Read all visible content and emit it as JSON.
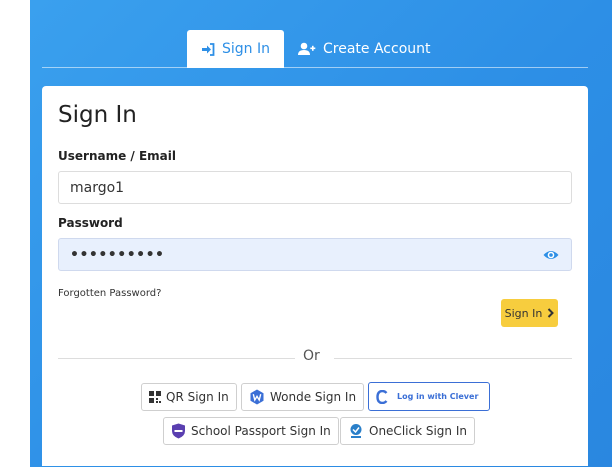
{
  "tabs": {
    "signin_label": "Sign In",
    "create_label": "Create Account"
  },
  "form": {
    "title": "Sign In",
    "username_label": "Username / Email",
    "username_value": "margo1",
    "password_label": "Password",
    "password_value": "••••••••••",
    "forgot_label": "Forgotten Password?",
    "submit_label": "Sign In"
  },
  "divider": {
    "text": "Or"
  },
  "sso": {
    "qr": "QR Sign In",
    "wonde": "Wonde Sign In",
    "clever": "Log in with Clever",
    "school_passport": "School Passport Sign In",
    "oneclick": "OneClick Sign In"
  },
  "colors": {
    "accent": "#2d8fe6",
    "button": "#f7cd3e",
    "clever": "#3b6fd6"
  }
}
